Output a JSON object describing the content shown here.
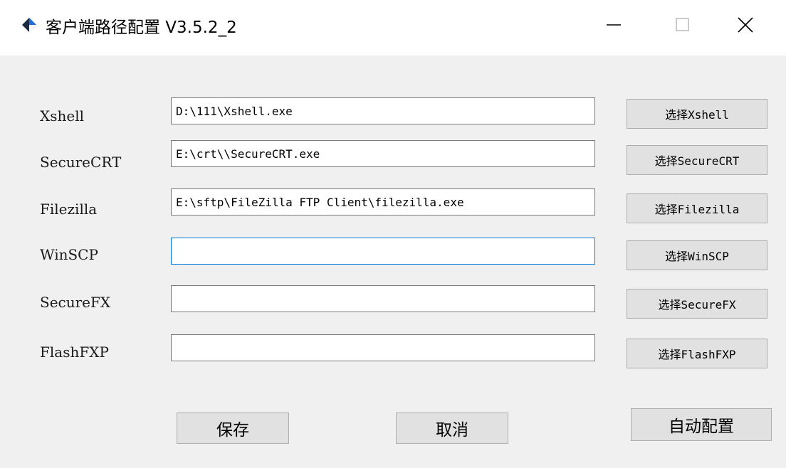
{
  "window": {
    "title": "客户端路径配置 V3.5.2_2",
    "icon": "app-diamond-icon",
    "controls": [
      "minimize-icon",
      "maximize-icon",
      "close-icon"
    ]
  },
  "rows": [
    {
      "label": "Xshell",
      "value": "D:\\111\\Xshell.exe",
      "button": "选择Xshell"
    },
    {
      "label": "SecureCRT",
      "value": "E:\\crt\\\\SecureCRT.exe",
      "button": "选择SecureCRT"
    },
    {
      "label": "Filezilla",
      "value": "E:\\sftp\\FileZilla FTP Client\\filezilla.exe",
      "button": "选择Filezilla"
    },
    {
      "label": "WinSCP",
      "value": "",
      "button": "选择WinSCP"
    },
    {
      "label": "SecureFX",
      "value": "",
      "button": "选择SecureFX"
    },
    {
      "label": "FlashFXP",
      "value": "",
      "button": "选择FlashFXP"
    }
  ],
  "footer": {
    "save": "保存",
    "cancel": "取消",
    "auto_config": "自动配置"
  },
  "colors": {
    "focus_border": "#0078d7",
    "app_icon_blue": "#1e6fd9",
    "app_icon_dark": "#1a2a40"
  }
}
